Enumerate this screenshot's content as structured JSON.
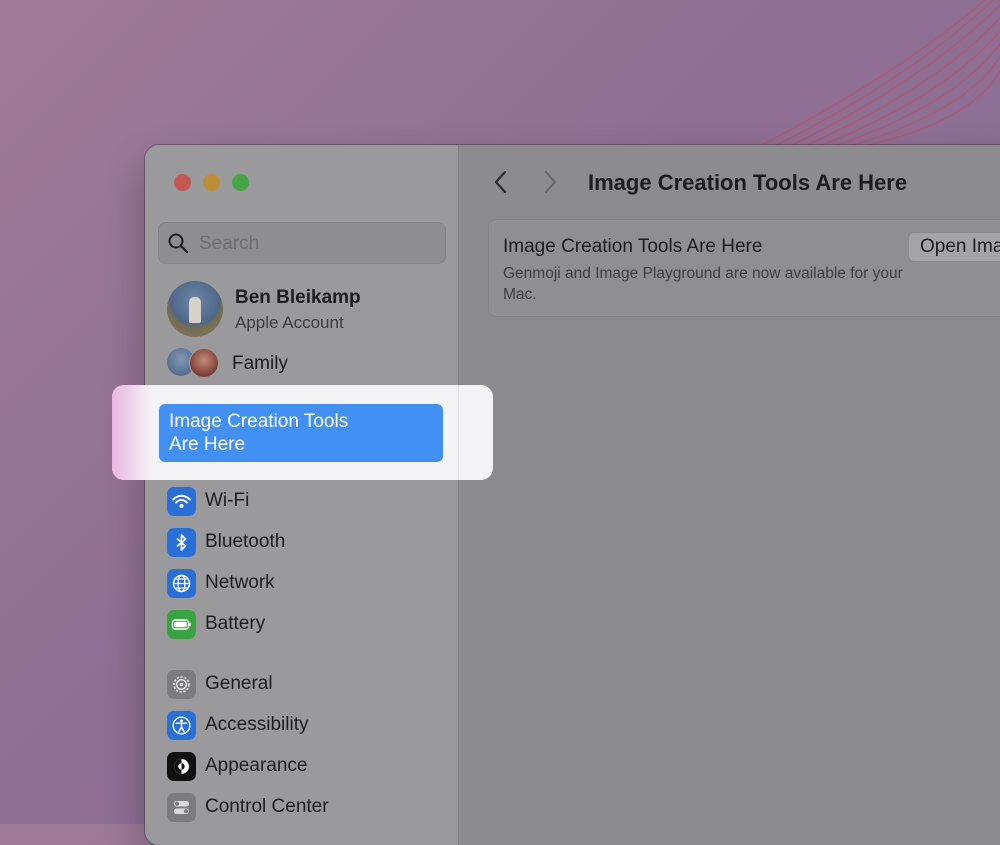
{
  "colors": {
    "accent": "#4290f4",
    "close": "#c45953",
    "minimize": "#bd8e3a",
    "zoom": "#47a548",
    "wallpaper": "#8e6f93"
  },
  "sidebar": {
    "search": {
      "placeholder": "Search",
      "icon": "search-icon"
    },
    "account": {
      "name": "Ben Bleikamp",
      "subtitle": "Apple Account"
    },
    "family": {
      "label": "Family"
    },
    "highlighted": {
      "label": "Image Creation Tools Are Here"
    },
    "items": [
      {
        "label": "Wi-Fi",
        "icon": "wifi-icon",
        "color": "#2a6fd6"
      },
      {
        "label": "Bluetooth",
        "icon": "bluetooth-icon",
        "color": "#2a6fd6"
      },
      {
        "label": "Network",
        "icon": "globe-icon",
        "color": "#2a6fd6"
      },
      {
        "label": "Battery",
        "icon": "battery-icon",
        "color": "#3aa341"
      },
      {
        "label": "General",
        "icon": "gear-icon",
        "color": "#7c7c7e"
      },
      {
        "label": "Accessibility",
        "icon": "accessibility-icon",
        "color": "#2a6fd6"
      },
      {
        "label": "Appearance",
        "icon": "appearance-icon",
        "color": "#111111"
      },
      {
        "label": "Control Center",
        "icon": "control-center-icon",
        "color": "#7c7c7e"
      }
    ]
  },
  "main": {
    "title": "Image Creation Tools Are Here",
    "card": {
      "title": "Image Creation Tools Are Here",
      "description": "Genmoji and Image Playground are now available for your Mac.",
      "button_label": "Open Image Playground"
    }
  }
}
